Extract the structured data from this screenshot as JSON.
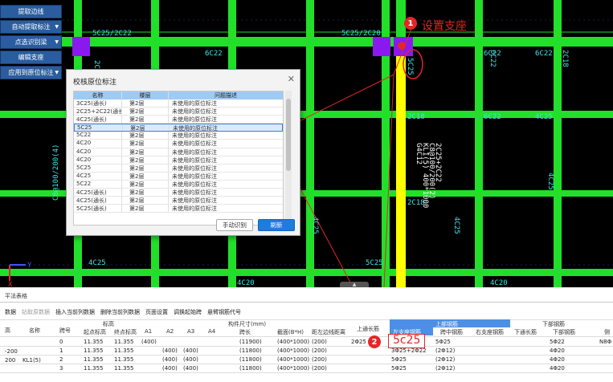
{
  "toolbar": {
    "buttons": [
      {
        "label": "提取边线",
        "dropdown": false
      },
      {
        "label": "自动提取标注",
        "dropdown": true
      },
      {
        "label": "点选识别梁",
        "dropdown": true
      },
      {
        "label": "编辑支座",
        "dropdown": false
      },
      {
        "label": "应用到原位标注",
        "dropdown": true
      }
    ]
  },
  "canvas": {
    "labels": [
      "5C25/2C22",
      "6C22",
      "5C25/2C20",
      "6C22",
      "6C22",
      "2C18",
      "4C25",
      "6C22",
      "4C20",
      "4C25",
      "4C20",
      "4C20",
      "5C25",
      "4C25",
      "6C20",
      "5C25",
      "KL1(5) 400*1000",
      "2C18",
      "4C25",
      "C8@100/200(2)"
    ],
    "axis": {
      "x": "X",
      "y": "Y"
    }
  },
  "dialog": {
    "title": "校核原位标注",
    "columns": [
      "名称",
      "楼层",
      "问题描述"
    ],
    "rows": [
      {
        "name": "3C25(通长)",
        "floor": "第2层",
        "issue": "未使用的原位标注",
        "selected": false
      },
      {
        "name": "2C25+2C22(通长)",
        "floor": "第2层",
        "issue": "未使用的原位标注",
        "selected": false
      },
      {
        "name": "4C25(通长)",
        "floor": "第2层",
        "issue": "未使用的原位标注",
        "selected": false
      },
      {
        "name": "5C25",
        "floor": "第2层",
        "issue": "未使用的原位标注",
        "selected": true
      },
      {
        "name": "5C22",
        "floor": "第2层",
        "issue": "未使用的原位标注",
        "selected": false
      },
      {
        "name": "4C20",
        "floor": "第2层",
        "issue": "未使用的原位标注",
        "selected": false
      },
      {
        "name": "4C20",
        "floor": "第2层",
        "issue": "未使用的原位标注",
        "selected": false
      },
      {
        "name": "4C20",
        "floor": "第2层",
        "issue": "未使用的原位标注",
        "selected": false
      },
      {
        "name": "5C25",
        "floor": "第2层",
        "issue": "未使用的原位标注",
        "selected": false
      },
      {
        "name": "4C25",
        "floor": "第2层",
        "issue": "未使用的原位标注",
        "selected": false
      },
      {
        "name": "5C22",
        "floor": "第2层",
        "issue": "未使用的原位标注",
        "selected": false
      },
      {
        "name": "4C25(通长)",
        "floor": "第2层",
        "issue": "未使用的原位标注",
        "selected": false
      },
      {
        "name": "4C25(通长)",
        "floor": "第2层",
        "issue": "未使用的原位标注",
        "selected": false
      },
      {
        "name": "5C25(通长)",
        "floor": "第2层",
        "issue": "未使用的原位标注",
        "selected": false
      }
    ],
    "btn_manual": "手动识别",
    "btn_refresh": "刷新",
    "close": "✕"
  },
  "annotations": {
    "step1_num": "1",
    "step1_text": "设置支座",
    "step2_num": "2",
    "step2_text": "5c25"
  },
  "panel": {
    "title": "平法表格",
    "collapse": "▲",
    "toolbar": [
      {
        "label": "数据",
        "dim": false
      },
      {
        "label": "钻取原数据",
        "dim": true
      },
      {
        "label": "插入当前列数据",
        "dim": false
      },
      {
        "label": "删除当前列数据",
        "dim": false
      },
      {
        "label": "页面设置",
        "dim": false
      },
      {
        "label": "调换起始跨",
        "dim": false
      },
      {
        "label": "悬臂钢筋代号",
        "dim": false
      }
    ],
    "headers": {
      "floor": "高",
      "name": "名称",
      "span": "跨号",
      "elev_group": "标高",
      "elev_start": "起点标高",
      "elev_end": "终点标高",
      "size_group": "构件尺寸(mm)",
      "a1": "A1",
      "a2": "A2",
      "a3": "A3",
      "a4": "A4",
      "span_len": "跨长",
      "section": "截面(B*H)",
      "edge_dist": "距左边线距离",
      "top_through": "上通长筋",
      "top_rebar_group": "上部钢筋",
      "left_support": "左支座钢筋",
      "mid_rebar": "跨中钢筋",
      "right_support": "右支座钢筋",
      "bottom_through": "下通长筋",
      "bottom_rebar_group": "下部钢筋",
      "bottom_rebar": "下部钢筋",
      "side": "侧"
    },
    "left_vals": [
      "-200",
      "200"
    ],
    "beam_name": "KL1(5)",
    "rows": [
      {
        "span": "0",
        "start": "11.355",
        "end": "11.355",
        "a1": "(400)",
        "a2": "",
        "a3": "",
        "a4": "",
        "len": "(11900)",
        "sec": "(400*1000)",
        "dist": "(200)",
        "top": "2Φ25",
        "left": "",
        "mid": "5Φ25",
        "right": "",
        "bot_through": "",
        "bottom": "5Φ22",
        "side": "N8Φ"
      },
      {
        "span": "1",
        "start": "11.355",
        "end": "11.355",
        "a1": "",
        "a2": "(400)",
        "a3": "(400)",
        "a4": "",
        "len": "(11800)",
        "sec": "(400*1000)",
        "dist": "(200)",
        "top": "",
        "left": "3Φ25+2Φ22",
        "mid": "(2Φ12)",
        "right": "",
        "bot_through": "",
        "bottom": "4Φ20",
        "side": ""
      },
      {
        "span": "2",
        "start": "11.355",
        "end": "11.355",
        "a1": "",
        "a2": "(400)",
        "a3": "(400)",
        "a4": "",
        "len": "(11800)",
        "sec": "(400*1000)",
        "dist": "(200)",
        "top": "",
        "left": "5Φ25",
        "mid": "(2Φ12)",
        "right": "",
        "bot_through": "",
        "bottom": "4Φ20",
        "side": ""
      },
      {
        "span": "3",
        "start": "11.355",
        "end": "11.355",
        "a1": "",
        "a2": "(400)",
        "a3": "(400)",
        "a4": "",
        "len": "(11800)",
        "sec": "(400*1000)",
        "dist": "(200)",
        "top": "",
        "left": "5Φ25",
        "mid": "(2Φ12)",
        "right": "",
        "bot_through": "",
        "bottom": "4Φ20",
        "side": ""
      }
    ]
  },
  "colors": {
    "beam_green": "#22e02a",
    "highlight_yellow": "#ffff00",
    "support_purple": "#8a19f0",
    "annotation_red": "#e32626",
    "toolbar_blue": "#2a5d9f"
  }
}
